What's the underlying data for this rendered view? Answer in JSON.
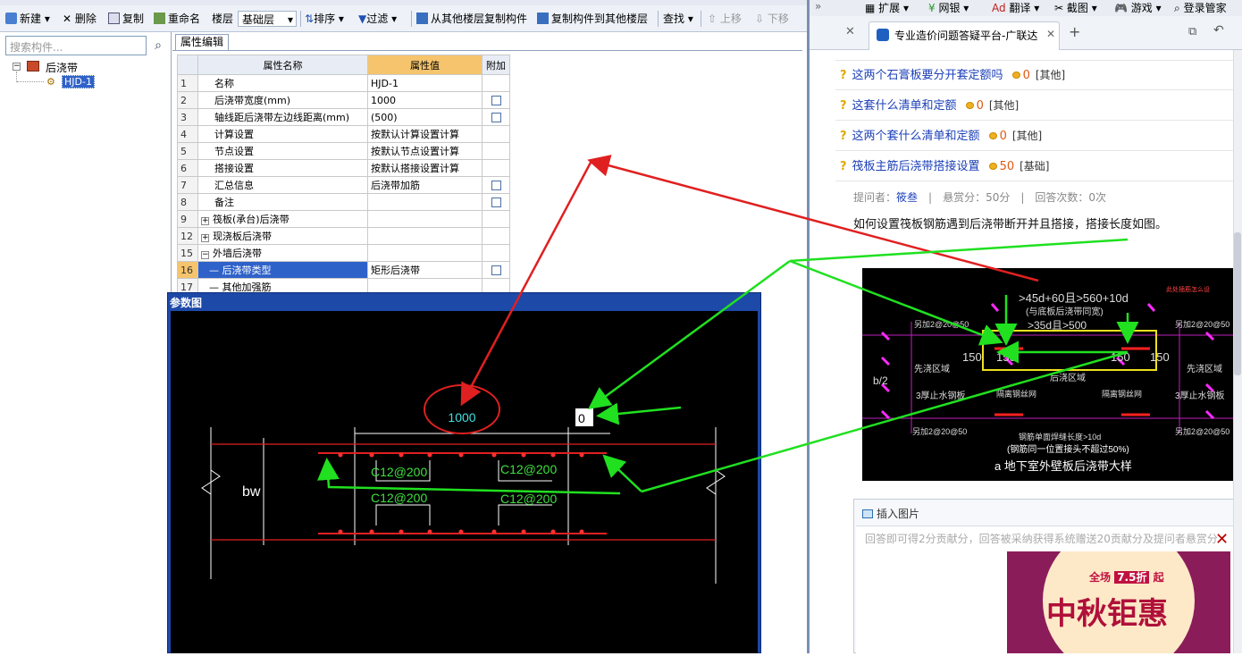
{
  "toolbar": {
    "new": "新建",
    "delete": "删除",
    "copy": "复制",
    "rename": "重命名",
    "layer": "楼层",
    "layer_value": "基础层",
    "sort": "排序",
    "filter": "过滤",
    "copy_from_other": "从其他楼层复制构件",
    "copy_to_other": "复制构件到其他楼层",
    "find": "查找",
    "move_up": "上移",
    "move_down": "下移"
  },
  "tree": {
    "search_placeholder": "搜索构件...",
    "root": "后浇带",
    "child": "HJD-1"
  },
  "props": {
    "tab": "属性编辑",
    "headers": [
      "属性名称",
      "属性值",
      "附加"
    ],
    "rows": [
      {
        "n": "1",
        "name": "名称",
        "value": "HJD-1"
      },
      {
        "n": "2",
        "name": "后浇带宽度(mm)",
        "value": "1000"
      },
      {
        "n": "3",
        "name": "轴线距后浇带左边线距离(mm)",
        "value": "(500)"
      },
      {
        "n": "4",
        "name": "计算设置",
        "value": "按默认计算设置计算"
      },
      {
        "n": "5",
        "name": "节点设置",
        "value": "按默认节点设置计算"
      },
      {
        "n": "6",
        "name": "搭接设置",
        "value": "按默认搭接设置计算"
      },
      {
        "n": "7",
        "name": "汇总信息",
        "value": "后浇带加筋"
      },
      {
        "n": "8",
        "name": "备注",
        "value": ""
      },
      {
        "n": "9",
        "name": "筏板(承台)后浇带",
        "value": ""
      },
      {
        "n": "12",
        "name": "现浇板后浇带",
        "value": ""
      },
      {
        "n": "15",
        "name": "外墙后浇带",
        "value": ""
      },
      {
        "n": "16",
        "name": "后浇带类型",
        "value": "矩形后浇带"
      },
      {
        "n": "17",
        "name": "其他加强筋",
        "value": ""
      }
    ]
  },
  "cad": {
    "title": "参数图",
    "width_label": "1000",
    "offset_label": "0",
    "bw": "bw",
    "rebar": [
      "C12@200",
      "C12@200",
      "C12@200",
      "C12@200"
    ]
  },
  "browser": {
    "top": {
      "ext": "扩展",
      "bank": "网银",
      "translate": "翻译",
      "shot": "截图",
      "game": "游戏",
      "login": "登录管家"
    },
    "tab_title": "专业造价问题答疑平台-广联达",
    "questions": [
      {
        "title": "这两个石膏板要分开套定额吗",
        "coins": "0",
        "cat": "[其他]"
      },
      {
        "title": "这套什么清单和定额",
        "coins": "0",
        "cat": "[其他]"
      },
      {
        "title": "这两个套什么清单和定额",
        "coins": "0",
        "cat": "[其他]"
      },
      {
        "title": "筏板主筋后浇带搭接设置",
        "coins": "50",
        "cat": "[基础]"
      }
    ],
    "meta": {
      "asker_label": "提问者：",
      "asker": "筱叁",
      "bounty": "悬赏分：50分",
      "answers": "回答次数：0次"
    },
    "question_body": "如何设置筏板钢筋遇到后浇带断开并且搭接，搭接长度如图。",
    "pic": {
      "top1": ">45d+60且>560+10d",
      "top2": "(与底板后浇带同宽)",
      "top3": ">35d且>500",
      "note": "此处插筋怎么设",
      "add_l": "另加2@20@50",
      "add_r": "另加2@20@50",
      "d150a": "150",
      "d150b": "150",
      "d150c": "150",
      "d150d": "150",
      "pre_l": "先浇区域",
      "pre_r": "先浇区域",
      "post": "后浇区域",
      "stop_l": "3厚止水钢板",
      "stop_r": "3厚止水钢板",
      "mesh_l": "隔离钢丝网",
      "mesh_r": "隔离钢丝网",
      "lap1": "钢筋单面焊缝长度>10d",
      "lap2": "(钢筋同一位置接头不超过50%)",
      "caption": "a 地下室外壁板后浇带大样",
      "add_bl": "另加2@20@50",
      "add_br": "另加2@20@50",
      "b2": "b/2"
    },
    "insert_image": "插入图片",
    "answer_placeholder": "回答即可得2分贡献分，回答被采纳获得系统赠送20贡献分及提问者悬赏分",
    "ad": {
      "line1": "全场",
      "discount": "7.5折",
      "qi": "起",
      "big": "中秋钜惠"
    }
  }
}
